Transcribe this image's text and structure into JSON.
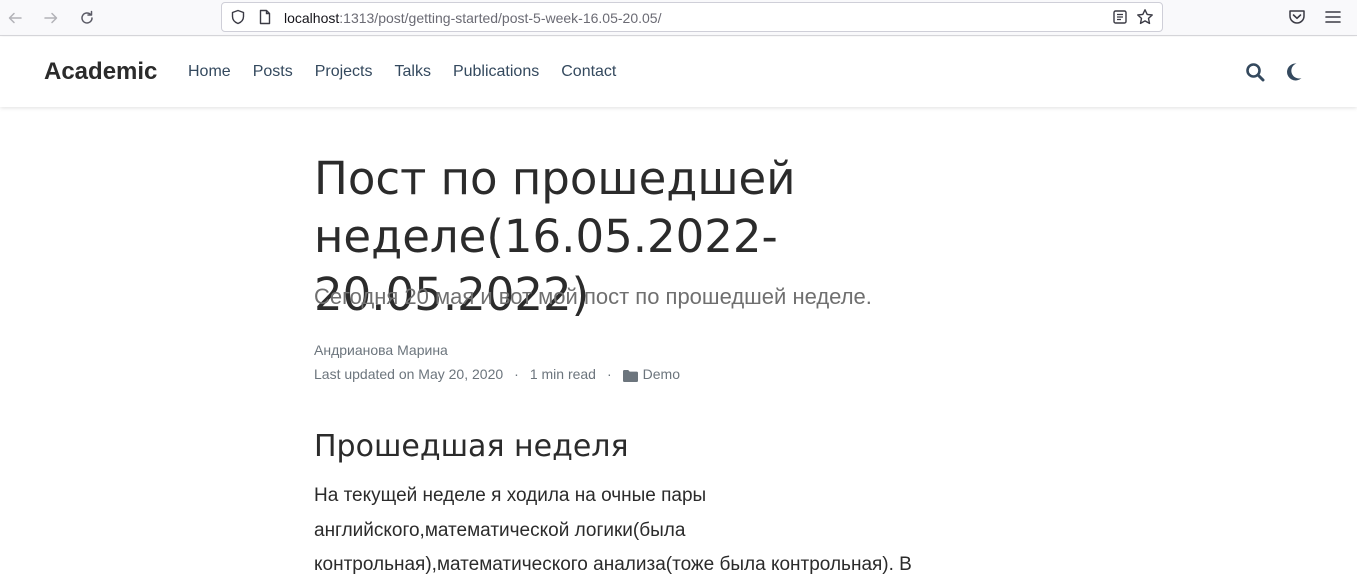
{
  "browser": {
    "url_host": "localhost",
    "url_rest": ":1313/post/getting-started/post-5-week-16.05-20.05/",
    "icons": [
      "back-arrow-icon",
      "forward-arrow-icon",
      "reload-icon",
      "shield-icon",
      "page-icon",
      "reader-mode-icon",
      "bookmark-star-icon",
      "pocket-icon",
      "hamburger-menu-icon"
    ]
  },
  "site": {
    "brand": "Academic",
    "menu": [
      "Home",
      "Posts",
      "Projects",
      "Talks",
      "Publications",
      "Contact"
    ],
    "icons": [
      "search-icon",
      "moon-icon"
    ]
  },
  "article": {
    "title_line1": "Пост по прошедшей",
    "title_line2": "неделе(16.05.2022-20.05.2022)",
    "subtitle": "Сегодня 20 мая и вот мой пост по прошедшей неделе.",
    "author": "Андрианова Марина",
    "last_updated": "Last updated on May 20, 2020",
    "separator": "·",
    "read_time": "1 min read",
    "category": "Demo",
    "section_title": "Прошедшая неделя",
    "paragraph_lines": [
      "На текущей неделе я ходила на очные пары",
      "английского,математической логики(была",
      "контрольная),математического анализа(тоже была контрольная). В"
    ]
  },
  "colors": {
    "text": "#2b2b2b",
    "nav_link": "#34495e",
    "muted": "#6c757d",
    "subtitle": "#6f6f6f"
  }
}
